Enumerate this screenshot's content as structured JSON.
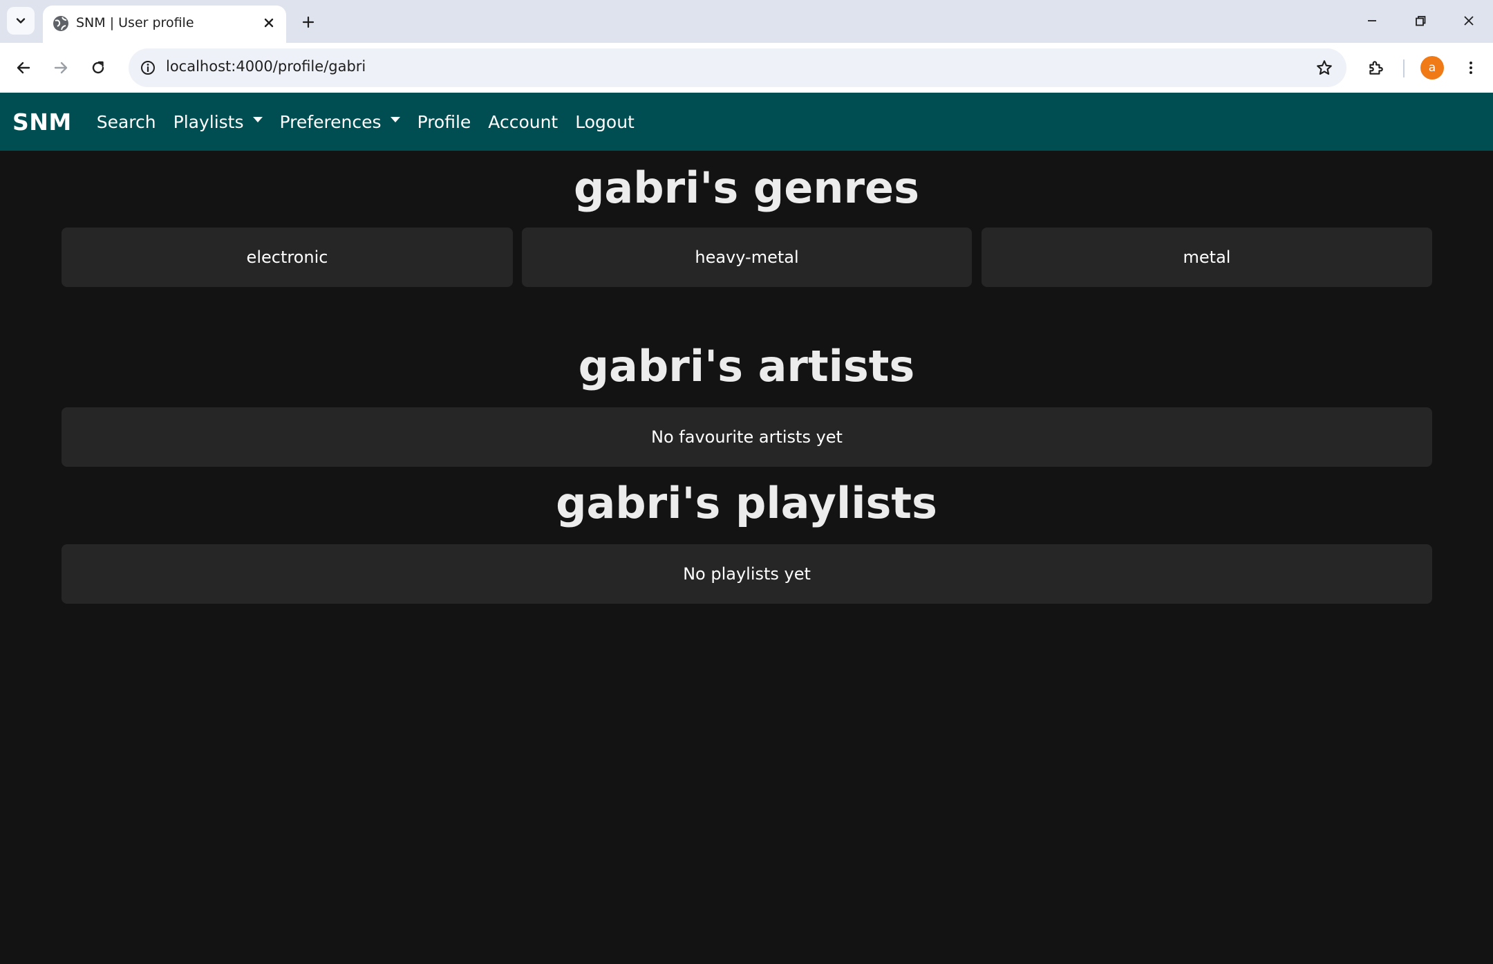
{
  "browser": {
    "tab_title": "SNM | User profile",
    "url": "localhost:4000/profile/gabri",
    "avatar_letter": "a"
  },
  "navbar": {
    "brand": "SNM",
    "links": {
      "search": "Search",
      "playlists": "Playlists",
      "preferences": "Preferences",
      "profile": "Profile",
      "account": "Account",
      "logout": "Logout"
    }
  },
  "genres": {
    "heading": "gabri's genres",
    "items": [
      "electronic",
      "heavy-metal",
      "metal"
    ]
  },
  "artists": {
    "heading": "gabri's artists",
    "empty_text": "No favourite artists yet"
  },
  "playlists": {
    "heading": "gabri's playlists",
    "empty_text": "No playlists yet"
  },
  "colors": {
    "navbar_bg": "#014e52",
    "page_bg": "#131313",
    "card_bg": "#262626",
    "avatar_bg": "#f07a16"
  }
}
